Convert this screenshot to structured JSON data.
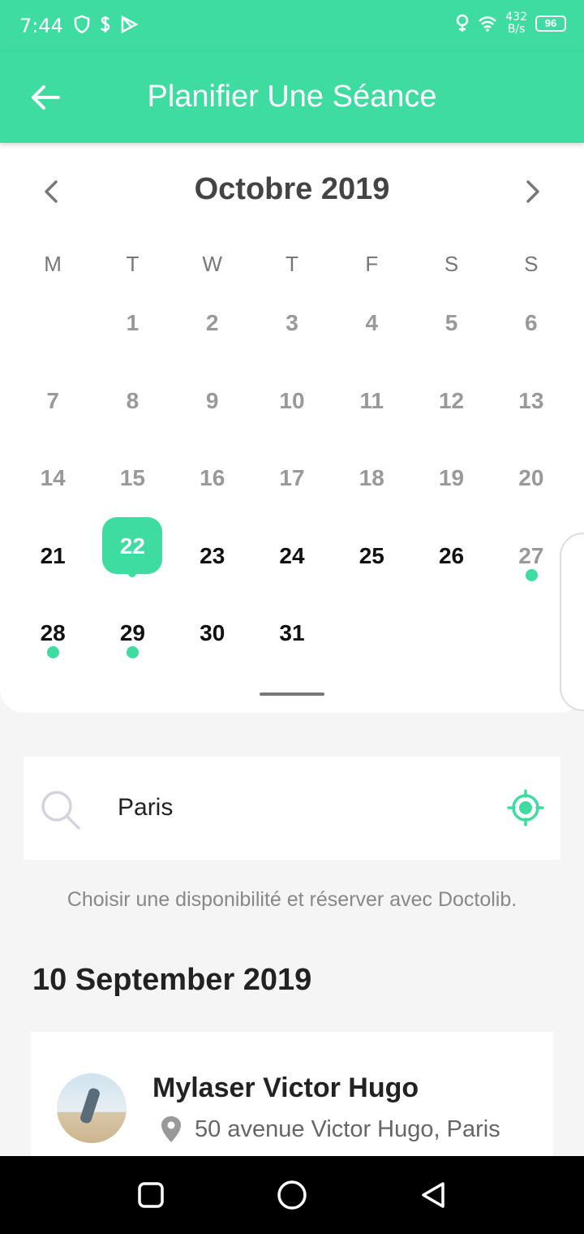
{
  "status_bar": {
    "time": "7:44",
    "net_speed_value": "432",
    "net_speed_unit": "B/s",
    "battery": "96"
  },
  "app_bar": {
    "title": "Planifier Une Séance"
  },
  "calendar": {
    "month_label": "Octobre 2019",
    "weekdays": [
      "M",
      "T",
      "W",
      "T",
      "F",
      "S",
      "S"
    ],
    "weeks": [
      [
        "",
        "1",
        "2",
        "3",
        "4",
        "5",
        "6"
      ],
      [
        "7",
        "8",
        "9",
        "10",
        "11",
        "12",
        "13"
      ],
      [
        "14",
        "15",
        "16",
        "17",
        "18",
        "19",
        "20"
      ],
      [
        "21",
        "22",
        "23",
        "24",
        "25",
        "26",
        "27"
      ],
      [
        "28",
        "29",
        "30",
        "31",
        "",
        "",
        ""
      ]
    ],
    "selected_day": "22",
    "days_with_availability": [
      "27",
      "28",
      "29"
    ]
  },
  "search": {
    "value": "Paris"
  },
  "hint_text": "Choisir une disponibilité et réserver avec Doctolib.",
  "date_heading": "10 September 2019",
  "results": [
    {
      "name": "Mylaser Victor Hugo",
      "address": "50 avenue Victor Hugo, Paris"
    }
  ],
  "colors": {
    "accent": "#3fdca2",
    "past_day": "#999999",
    "future_day": "#111111"
  }
}
